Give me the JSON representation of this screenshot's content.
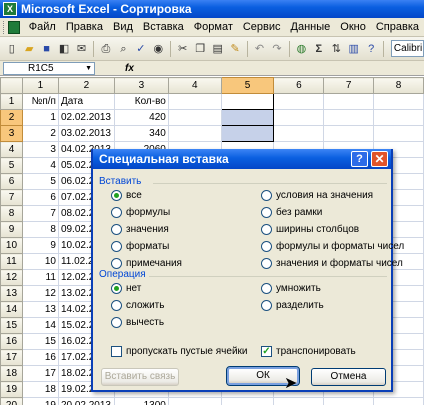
{
  "window": {
    "title": "Microsoft Excel - Сортировка"
  },
  "menu": [
    "Файл",
    "Правка",
    "Вид",
    "Вставка",
    "Формат",
    "Сервис",
    "Данные",
    "Окно",
    "Справка"
  ],
  "toolbar": {
    "font_name": "Calibri"
  },
  "formula_bar": {
    "name_box": "R1C5",
    "fx": "fx"
  },
  "sheet": {
    "column_headers": [
      "1",
      "2",
      "3",
      "4",
      "5",
      "6",
      "7",
      "8"
    ],
    "rows": [
      {
        "n": "1",
        "a": "№п/п",
        "b": "Дата",
        "c": "Кол-во"
      },
      {
        "n": "2",
        "a": "1",
        "b": "02.02.2013",
        "c": "420"
      },
      {
        "n": "3",
        "a": "2",
        "b": "03.02.2013",
        "c": "340"
      },
      {
        "n": "4",
        "a": "3",
        "b": "04.02.2013",
        "c": "2060"
      },
      {
        "n": "5",
        "a": "4",
        "b": "05.02.2",
        "c": ""
      },
      {
        "n": "6",
        "a": "5",
        "b": "06.02.2",
        "c": ""
      },
      {
        "n": "7",
        "a": "6",
        "b": "07.02.2",
        "c": ""
      },
      {
        "n": "8",
        "a": "7",
        "b": "08.02.2",
        "c": ""
      },
      {
        "n": "9",
        "a": "8",
        "b": "09.02.2",
        "c": ""
      },
      {
        "n": "10",
        "a": "9",
        "b": "10.02.2",
        "c": ""
      },
      {
        "n": "11",
        "a": "10",
        "b": "11.02.2",
        "c": ""
      },
      {
        "n": "12",
        "a": "11",
        "b": "12.02.2",
        "c": ""
      },
      {
        "n": "13",
        "a": "12",
        "b": "13.02.2",
        "c": ""
      },
      {
        "n": "14",
        "a": "13",
        "b": "14.02.2",
        "c": ""
      },
      {
        "n": "15",
        "a": "14",
        "b": "15.02.2",
        "c": ""
      },
      {
        "n": "16",
        "a": "15",
        "b": "16.02.2",
        "c": ""
      },
      {
        "n": "17",
        "a": "16",
        "b": "17.02.2",
        "c": ""
      },
      {
        "n": "18",
        "a": "17",
        "b": "18.02.2",
        "c": ""
      },
      {
        "n": "19",
        "a": "18",
        "b": "19.02.2",
        "c": ""
      },
      {
        "n": "20",
        "a": "19",
        "b": "20.02.2013",
        "c": "1300"
      }
    ]
  },
  "dialog": {
    "title": "Специальная вставка",
    "help_label": "?",
    "close_label": "✕",
    "paste_group": "Вставить",
    "paste_left": [
      "все",
      "формулы",
      "значения",
      "форматы",
      "примечания"
    ],
    "paste_right": [
      "условия на значения",
      "без рамки",
      "ширины столбцов",
      "формулы и форматы чисел",
      "значения и форматы чисел"
    ],
    "operation_group": "Операция",
    "op_left": [
      "нет",
      "сложить",
      "вычесть"
    ],
    "op_right": [
      "умножить",
      "разделить"
    ],
    "skip_blanks": "пропускать пустые ячейки",
    "transpose": "транспонировать",
    "paste_link": "Вставить связь",
    "ok": "ОК",
    "cancel": "Отмена",
    "selected_paste": "все",
    "selected_operation": "нет",
    "skip_blanks_checked": false,
    "transpose_checked": true
  }
}
